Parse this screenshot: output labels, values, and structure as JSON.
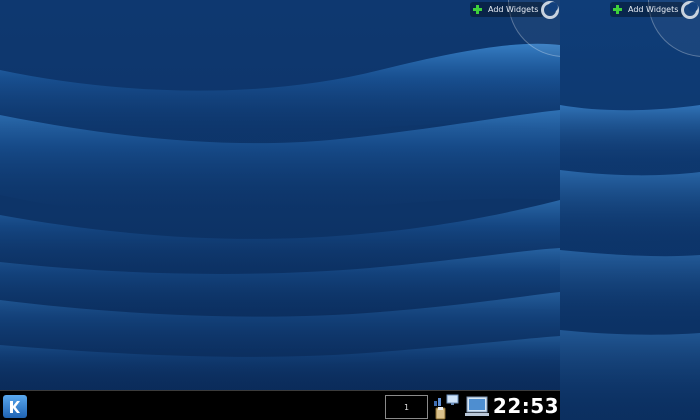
{
  "desktop": {
    "add_widgets_label": "Add Widgets"
  },
  "panel": {
    "pager_label": "1",
    "clock": "22:53"
  },
  "icons": {
    "launcher": "kde-kickoff-icon",
    "cashew": "plasma-cashew-icon",
    "add": "plus-icon",
    "network": "network-icon",
    "klipper": "clipboard-icon",
    "device_notifier": "computer-icon"
  },
  "colors": {
    "wallpaper_dark": "#0b2a55",
    "wallpaper_light": "#2f7bc4",
    "panel_bg": "#000000",
    "add_icon": "#3fd13a",
    "clock_text": "#ffffff"
  }
}
